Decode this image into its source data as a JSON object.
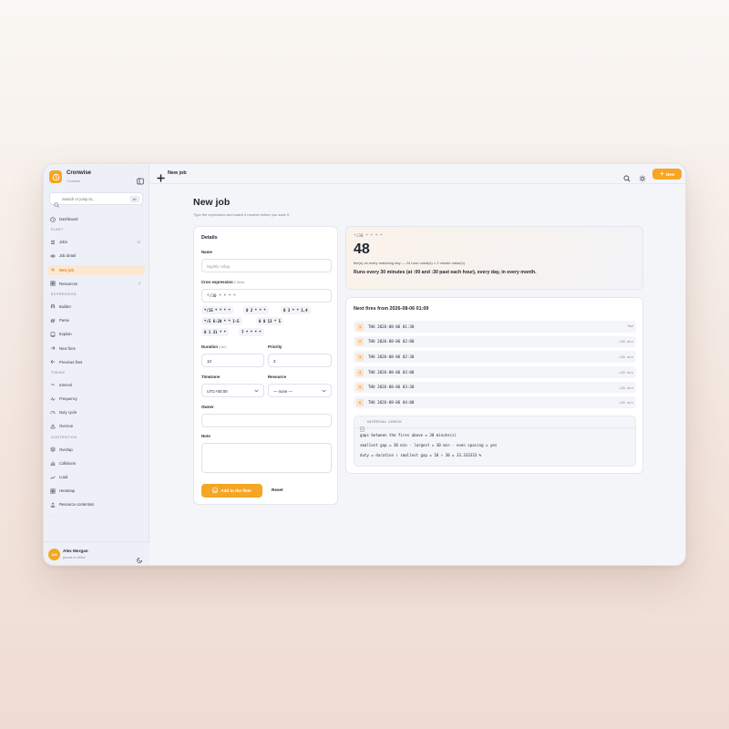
{
  "app": {
    "name": "Cronwise",
    "workspace": "Cronwise",
    "search_placeholder": "Search or jump to...",
    "search_shortcut": "⌘K"
  },
  "nav": {
    "dashboard": "Dashboard",
    "sections": {
      "fleet": "FLEET",
      "expression": "EXPRESSION",
      "timing": "TIMING",
      "contention": "CONTENTION"
    },
    "fleet": [
      {
        "label": "Jobs",
        "count": "13",
        "icon": "list-icon"
      },
      {
        "label": "Job detail",
        "count": "",
        "icon": "eye-icon"
      },
      {
        "label": "New job",
        "count": "",
        "icon": "plus-icon"
      },
      {
        "label": "Resources",
        "count": "4",
        "icon": "grid-icon"
      }
    ],
    "expression": [
      {
        "label": "Builder",
        "icon": "sliders-icon"
      },
      {
        "label": "Parse",
        "icon": "hash-icon"
      },
      {
        "label": "Explain",
        "icon": "book-icon"
      },
      {
        "label": "Next fires",
        "icon": "arrow-right-icon"
      },
      {
        "label": "Previous fires",
        "icon": "arrow-left-icon"
      }
    ],
    "timing": [
      {
        "label": "Interval",
        "icon": "minus-icon"
      },
      {
        "label": "Frequency",
        "icon": "pulse-icon"
      },
      {
        "label": "Duty cycle",
        "icon": "gauge-icon"
      },
      {
        "label": "Overrun",
        "icon": "warning-icon"
      }
    ],
    "contention": [
      {
        "label": "Overlap",
        "icon": "layers-icon"
      },
      {
        "label": "Collisions",
        "icon": "bar-chart-icon"
      },
      {
        "label": "Load",
        "icon": "trend-icon"
      },
      {
        "label": "Heatmap",
        "icon": "grid-icon"
      },
      {
        "label": "Resource contention",
        "icon": "stack-icon"
      }
    ]
  },
  "user": {
    "initials": "AM",
    "name": "Alex Morgan",
    "status": "private & offline"
  },
  "topbar": {
    "title": "New job",
    "new_label": "New"
  },
  "page": {
    "title": "New job",
    "subtitle": "Type the expression and watch it resolve before you save it"
  },
  "form": {
    "heading": "Details",
    "name_label": "Name",
    "name_placeholder": "Nightly rollup",
    "cron_label": "Cron expression",
    "cron_hint": "5 fields",
    "cron_value": "*/30 * * * *",
    "presets": [
      "*/15 * * * *",
      "0 2 * * *",
      "0 3 * * 1,4",
      "*/5 6-20 * * 1-5",
      "0 0 13 * 5",
      "0 1 31 * *",
      "7 * * * *"
    ],
    "duration_label": "Duration",
    "duration_hint": "(min)",
    "duration_value": "10",
    "priority_label": "Priority",
    "priority_value": "3",
    "timezone_label": "Timezone",
    "timezone_value": "UTC+00:00",
    "resource_label": "Resource",
    "resource_value": "— none —",
    "owner_label": "Owner",
    "owner_value": "",
    "note_label": "Note",
    "note_value": "",
    "submit_label": "Add to the fleet",
    "reset_label": "Reset"
  },
  "summary": {
    "expression": "*/30 * * * *",
    "count": "48",
    "formula": "fire(s) on every matching day — 24 hour value(s) × 2 minute value(s)",
    "description": "Runs every 30 minutes (at :00 and :30 past each hour), every day, in every month."
  },
  "fires": {
    "heading": "Next fires from 2026-08-06 01:09",
    "rows": [
      {
        "idx": "1",
        "time": "THU 2026-08-06 01:30",
        "gap": "first"
      },
      {
        "idx": "2",
        "time": "THU 2026-08-06 02:00",
        "gap": "+30 min"
      },
      {
        "idx": "3",
        "time": "THU 2026-08-06 02:30",
        "gap": "+30 min"
      },
      {
        "idx": "4",
        "time": "THU 2026-08-06 03:00",
        "gap": "+30 min"
      },
      {
        "idx": "5",
        "time": "THU 2026-08-06 03:30",
        "gap": "+30 min"
      },
      {
        "idx": "6",
        "time": "THU 2026-08-06 04:00",
        "gap": "+30 min"
      }
    ],
    "interval_heading": "INTERVAL CHECK",
    "interval_lines": [
      "gaps between the fires above = 30 minute(s)",
      "smallest gap = 30 min · largest = 30 min · even spacing = yes",
      "duty = duration ÷ smallest gap = 10 ÷ 30 = 33.333333 %"
    ]
  },
  "colors": {
    "accent": "#f6a623",
    "active_bg": "#fbe8d3"
  }
}
